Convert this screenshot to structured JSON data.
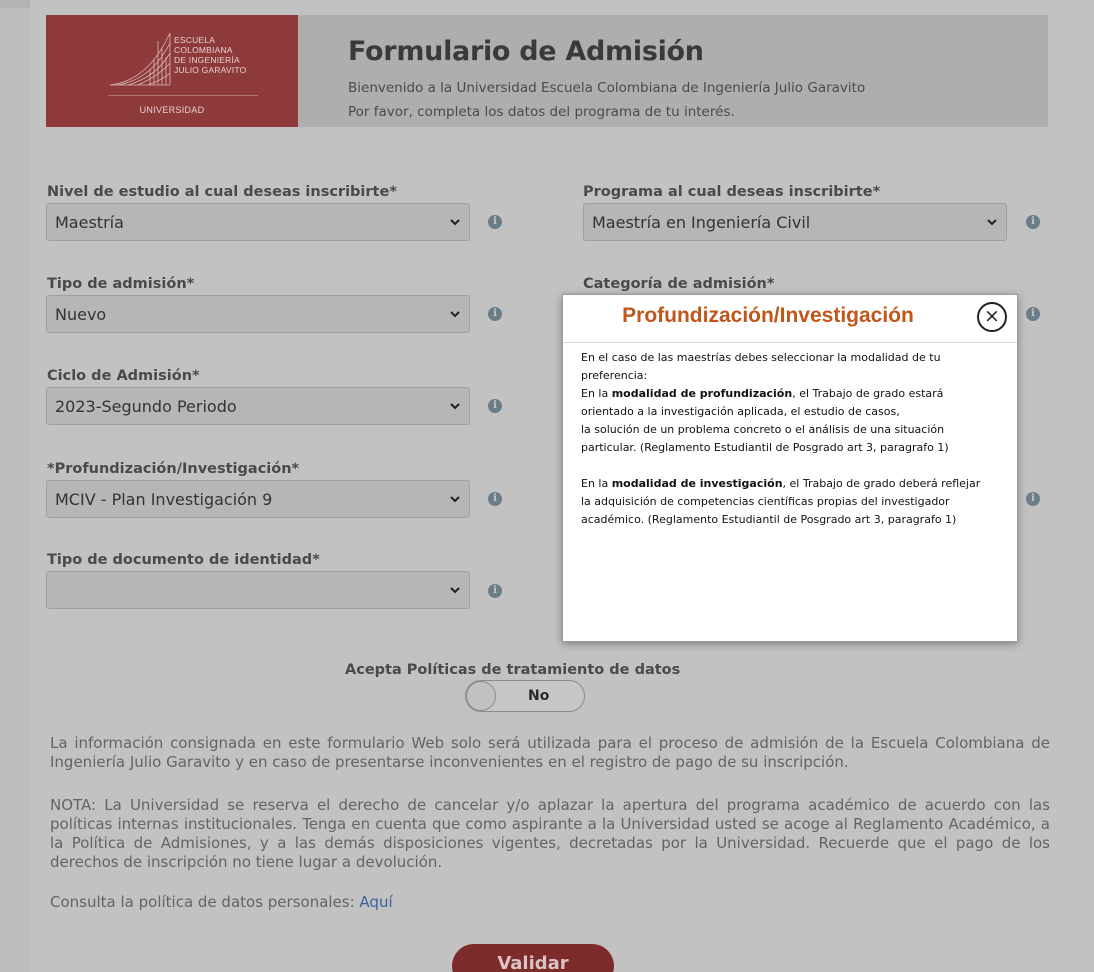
{
  "header": {
    "logo_lines": [
      "ESCUELA",
      "COLOMBIANA",
      "DE INGENIERÍA",
      "JULIO GARAVITO"
    ],
    "logo_sub": "UNIVERSIDAD",
    "title": "Formulario de Admisión",
    "welcome": "Bienvenido a la Universidad Escuela Colombiana de Ingeniería Julio Garavito",
    "instruction": "Por favor, completa los datos del programa de tu interés."
  },
  "form": {
    "nivel": {
      "label": "Nivel de estudio al cual deseas inscribirte*",
      "value": "Maestría"
    },
    "programa": {
      "label": "Programa al cual deseas inscribirte*",
      "value": "Maestría en Ingeniería Civil"
    },
    "tipo_admision": {
      "label": "Tipo de admisión*",
      "value": "Nuevo"
    },
    "categoria": {
      "label": "Categoría de admisión*",
      "value": ""
    },
    "ciclo": {
      "label": "Ciclo de Admisión*",
      "value": "2023-Segundo Periodo"
    },
    "profundizacion": {
      "label": "*Profundización/Investigación*",
      "value": "MCIV - Plan Investigación 9"
    },
    "tipo_documento": {
      "label": "Tipo de documento de identidad*",
      "value": ""
    }
  },
  "policies": {
    "label": "Acepta Políticas de tratamiento de datos",
    "toggle_value": "No"
  },
  "texts": {
    "info_use": "La información consignada en este formulario Web solo será utilizada para el proceso de admisión de la Escuela Colombiana de Ingeniería Julio Garavito y en caso de presentarse inconvenientes en el registro de pago de su inscripción.",
    "note": "NOTA: La Universidad se reserva el derecho de cancelar y/o aplazar la apertura del programa académico de acuerdo con las políticas internas institucionales. Tenga en cuenta que como aspirante a la Universidad usted se acoge al Reglamento Académico, a la Política de Admisiones, y a las demás disposiciones vigentes, decretadas por la Universidad. Recuerde que el pago de los derechos de inscripción no tiene lugar a devolución.",
    "consulta_prefix": "Consulta la política de datos personales: ",
    "consulta_link": "Aquí"
  },
  "validar_label": "Validar",
  "modal": {
    "title": "Profundización/Investigación",
    "close_glyph": "×",
    "intro_1": "En el caso de las maestrías debes seleccionar la modalidad de tu",
    "intro_2": "preferencia:",
    "prof_pre": "En la ",
    "prof_bold": "modalidad de profundización",
    "prof_post": ", el Trabajo de grado estará",
    "prof_2": "orientado a la investigación aplicada, el estudio de casos,",
    "prof_3": "la solución de un problema concreto o el análisis de una situación",
    "prof_4": "particular.  (Reglamento Estudiantil de Posgrado art 3, paragrafo 1)",
    "inv_pre": "En la ",
    "inv_bold": "modalidad de investigación",
    "inv_post": ", el Trabajo de grado deberá reflejar",
    "inv_2": "la adquisición de competencias científicas propias del investigador",
    "inv_3": "académico.  (Reglamento Estudiantil de Posgrado art 3, paragrafo 1)"
  },
  "colors": {
    "brand": "#8f3a3a",
    "modal_title": "#c0561a",
    "info_icon": "#6c7d8a",
    "link": "#3d5fa0"
  },
  "icons": [
    "chevron-down-icon",
    "info-icon",
    "close-icon",
    "logo-grid-icon"
  ]
}
